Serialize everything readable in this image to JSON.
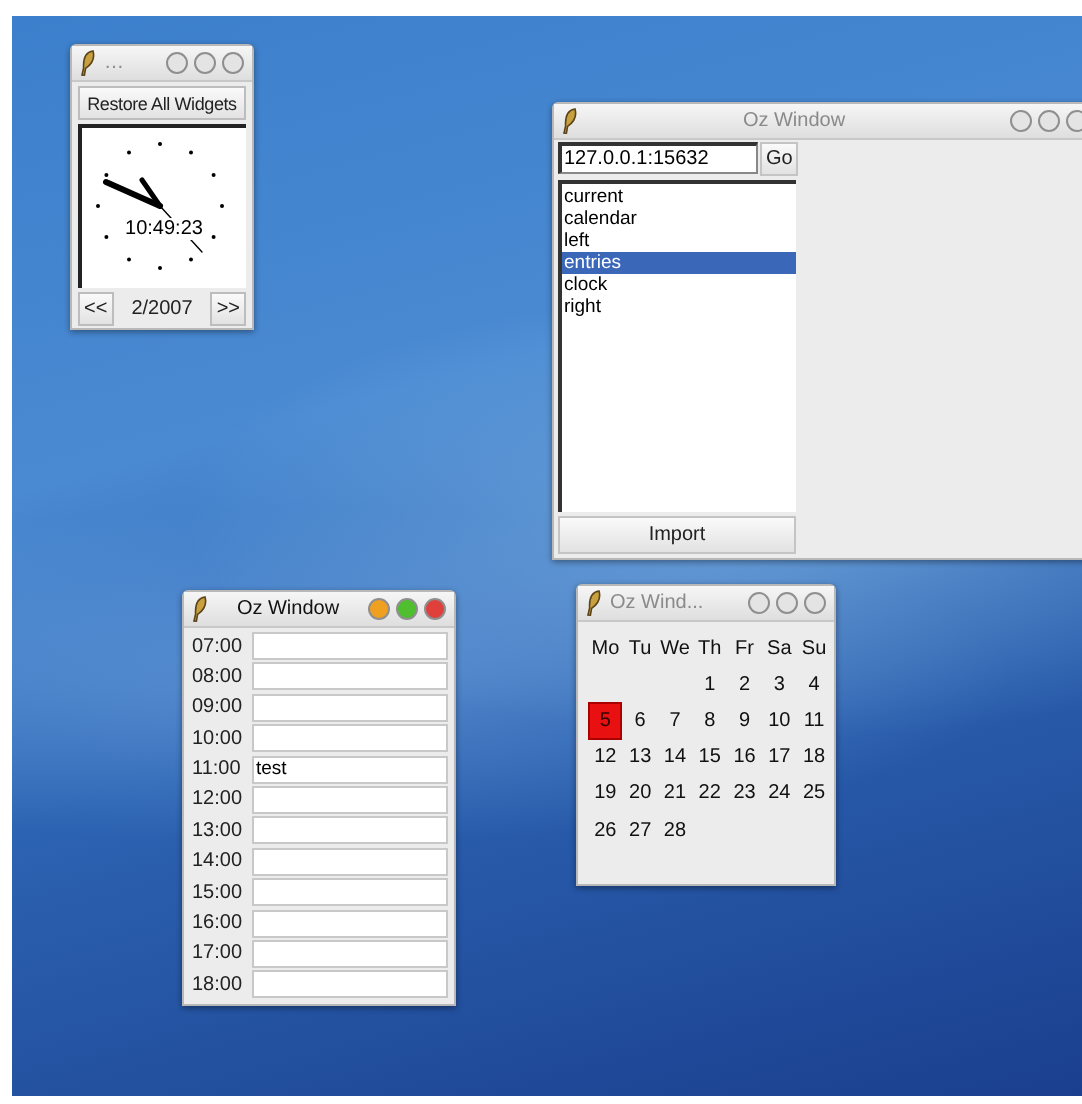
{
  "clock_window": {
    "title": "…",
    "active": false,
    "title_buttons": [
      {
        "color": "#e4e4e4"
      },
      {
        "color": "#e4e4e4"
      },
      {
        "color": "#e4e4e4"
      }
    ],
    "restore_button": "Restore All Widgets",
    "time": "10:49:23",
    "prev_button": "<<",
    "month": "2/2007",
    "next_button": ">>"
  },
  "browser_window": {
    "title": "Oz Window",
    "active": false,
    "title_buttons": [
      {
        "color": "#e4e4e4"
      },
      {
        "color": "#e4e4e4"
      },
      {
        "color": "#e4e4e4"
      }
    ],
    "address": "127.0.0.1:15632",
    "go_button": "Go",
    "list": [
      {
        "label": "current",
        "selected": false
      },
      {
        "label": "calendar",
        "selected": false
      },
      {
        "label": "left",
        "selected": false
      },
      {
        "label": "entries",
        "selected": true
      },
      {
        "label": "clock",
        "selected": false
      },
      {
        "label": "right",
        "selected": false
      }
    ],
    "import_button": "Import"
  },
  "entries_window": {
    "title": "Oz Window",
    "active": true,
    "title_buttons": [
      {
        "color": "#f0a020"
      },
      {
        "color": "#4fbf2f"
      },
      {
        "color": "#e0403c"
      }
    ],
    "entries": [
      {
        "time": "07:00"
      },
      {
        "time": "08:00"
      },
      {
        "time": "09:00"
      },
      {
        "time": "10:00"
      },
      {
        "time": "11:00",
        "value": "test"
      },
      {
        "time": "12:00"
      },
      {
        "time": "13:00"
      },
      {
        "time": "14:00"
      },
      {
        "time": "15:00"
      },
      {
        "time": "16:00"
      },
      {
        "time": "17:00"
      },
      {
        "time": "18:00"
      }
    ]
  },
  "calendar_window": {
    "title": "Oz Wind...",
    "active": false,
    "title_buttons": [
      {
        "color": "#e4e4e4"
      },
      {
        "color": "#e4e4e4"
      },
      {
        "color": "#e4e4e4"
      }
    ],
    "weekdays": [
      "Mo",
      "Tu",
      "We",
      "Th",
      "Fr",
      "Sa",
      "Su"
    ],
    "weeks": [
      [
        {
          "day": "1",
          "selected": false
        },
        {
          "day": "2",
          "selected": false
        },
        {
          "day": "3",
          "selected": false
        },
        {
          "day": "4",
          "selected": false
        }
      ],
      [
        {
          "day": "5",
          "selected": true
        },
        {
          "day": "6",
          "selected": false
        },
        {
          "day": "7",
          "selected": false
        },
        {
          "day": "8",
          "selected": false
        },
        {
          "day": "9",
          "selected": false
        },
        {
          "day": "10",
          "selected": false
        },
        {
          "day": "11",
          "selected": false
        }
      ],
      [
        {
          "day": "12",
          "selected": false
        },
        {
          "day": "13",
          "selected": false
        },
        {
          "day": "14",
          "selected": false
        },
        {
          "day": "15",
          "selected": false
        },
        {
          "day": "16",
          "selected": false
        },
        {
          "day": "17",
          "selected": false
        },
        {
          "day": "18",
          "selected": false
        }
      ],
      [
        {
          "day": "19",
          "selected": false
        },
        {
          "day": "20",
          "selected": false
        },
        {
          "day": "21",
          "selected": false
        },
        {
          "day": "22",
          "selected": false
        },
        {
          "day": "23",
          "selected": false
        },
        {
          "day": "24",
          "selected": false
        },
        {
          "day": "25",
          "selected": false
        }
      ],
      [
        {
          "day": "26",
          "selected": false
        },
        {
          "day": "27",
          "selected": false
        },
        {
          "day": "28",
          "selected": false
        }
      ]
    ]
  }
}
